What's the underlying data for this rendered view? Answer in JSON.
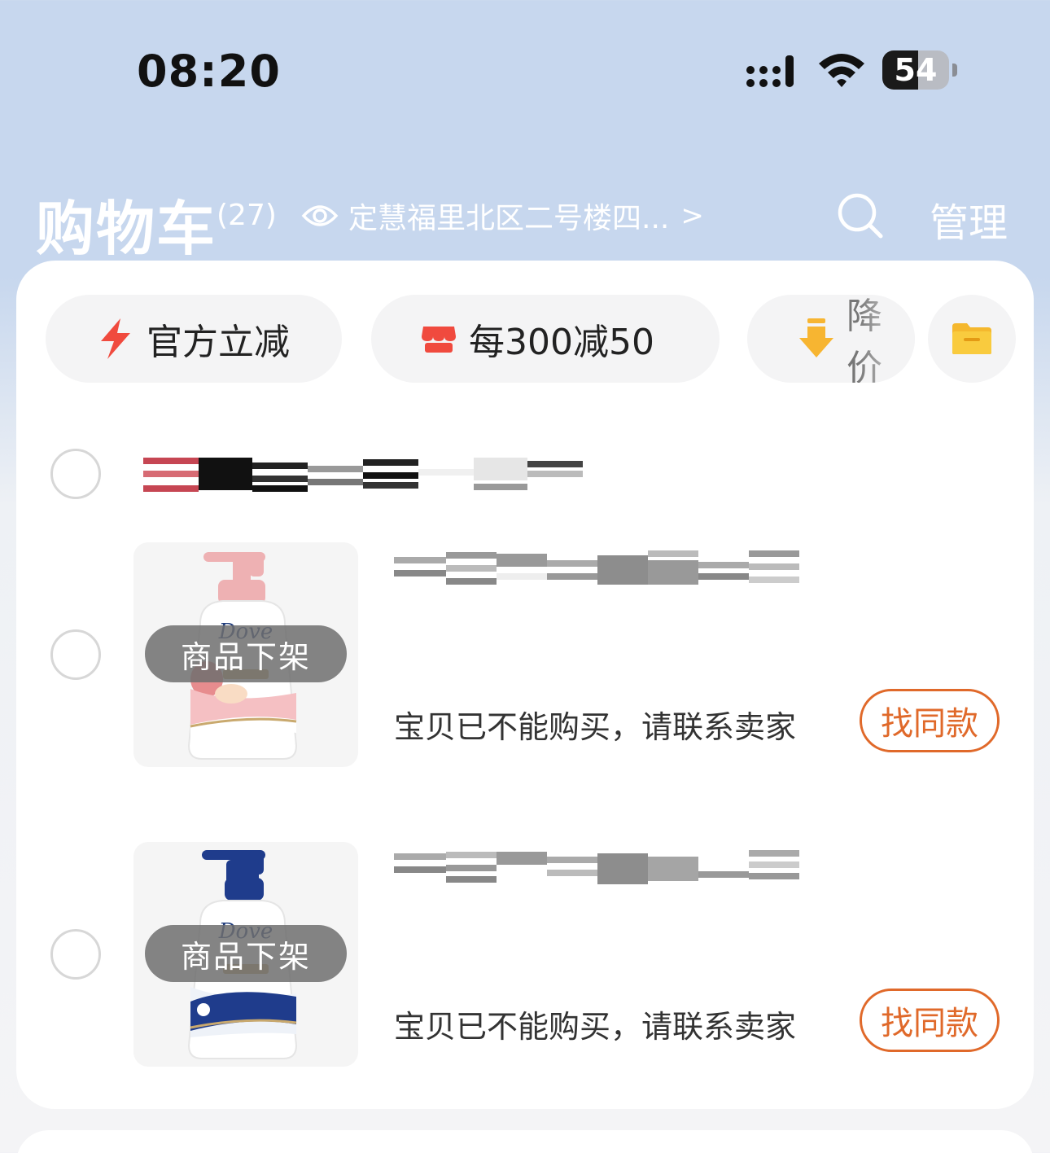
{
  "status_bar": {
    "time": "08:20",
    "battery_percent": 54,
    "battery_label": "54"
  },
  "header": {
    "title": "购物车",
    "count": "(27)",
    "address": "定慧福里北区二号楼四...",
    "address_chevron": ">",
    "manage_label": "管理"
  },
  "filter_chips": [
    {
      "label": "官方立减",
      "icon": "lightning-icon"
    },
    {
      "label": "每300减50",
      "icon": "shop-icon"
    },
    {
      "label": "降价",
      "icon": "arrow-down-icon"
    }
  ],
  "shop": {
    "name_redacted": true
  },
  "items": [
    {
      "status_badge": "商品下架",
      "message": "宝贝已不能购买，请联系卖家",
      "action_label": "找同款",
      "product_brand": "Dove",
      "cap_color": "#eeb1b3"
    },
    {
      "status_badge": "商品下架",
      "message": "宝贝已不能购买，请联系卖家",
      "action_label": "找同款",
      "product_brand": "Dove",
      "cap_color": "#1f3c8c"
    }
  ],
  "colors": {
    "accent": "#e0692a",
    "header_bg": "#c7d7ee"
  }
}
